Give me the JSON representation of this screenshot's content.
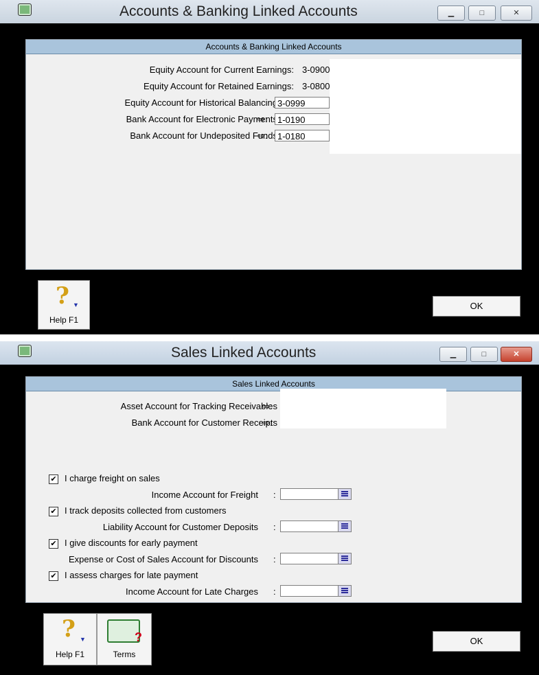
{
  "window1": {
    "title": "Accounts & Banking Linked Accounts",
    "controls": [
      "▁",
      "□",
      "✕"
    ],
    "panel_header": "Accounts & Banking Linked Accounts",
    "rows": [
      {
        "label": "Equity Account for Current Earnings:",
        "value": "3-0900"
      },
      {
        "label": "Equity Account for Retained Earnings:",
        "value": "3-0800"
      },
      {
        "label": "Equity Account for Historical Balancing",
        "value": "3-0999"
      },
      {
        "label": "Bank Account for Electronic Payments",
        "value": "1-0190"
      },
      {
        "label": "Bank Account for Undeposited Funds",
        "value": "1-0180"
      }
    ],
    "arrow_glyph": "⇨:",
    "help_label": "Help F1",
    "ok_label": "OK"
  },
  "window2": {
    "title": "Sales Linked Accounts",
    "controls": [
      "▁",
      "□",
      "✕"
    ],
    "panel_header": "Sales Linked Accounts",
    "rows": [
      {
        "label": "Asset Account for Tracking Receivables",
        "value": ""
      },
      {
        "label": "Bank Account for Customer Receipts",
        "value": ""
      }
    ],
    "arrow_glyph": "⇨:",
    "options": [
      {
        "check_label": "I charge freight on sales",
        "checked": "✔",
        "account_label": "Income Account for Freight"
      },
      {
        "check_label": "I track deposits collected from customers",
        "checked": "✔",
        "account_label": "Liability Account for Customer Deposits"
      },
      {
        "check_label": "I give discounts for early payment",
        "checked": "✔",
        "account_label": "Expense or Cost of Sales Account for Discounts"
      },
      {
        "check_label": "I assess charges for late payment",
        "checked": "✔",
        "account_label": "Income Account for Late Charges"
      }
    ],
    "colon": ":",
    "help_label": "Help F1",
    "terms_label": "Terms",
    "ok_label": "OK"
  }
}
